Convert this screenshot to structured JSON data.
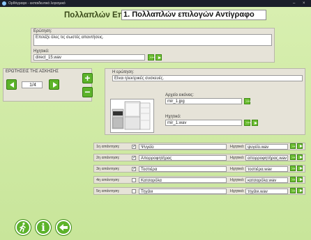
{
  "window": {
    "title": "Ορθόγραφο - εκπαιδευτικό λογισμικό"
  },
  "header": {
    "label": "Πολλαπλών Επιλογών:",
    "name_value": "1. Πολλαπλών επιλογών Αντίγραφο"
  },
  "instruction": {
    "label": "Ερώτηση:",
    "text": "Επιλέξε όλες τις σωστές απαντήσεις.",
    "sound_label": "Ηχητικό:",
    "sound_file": "direct_15.wav"
  },
  "questions_nav": {
    "label": "ΕΡΩΤΗΣΕΙΣ ΤΗΣ ΑΣΚΗΣΗΣ",
    "counter": "1/4"
  },
  "question": {
    "label": "Η ερώτηση:",
    "text": "Είναι ηλεκτρικές συσκευές.",
    "image_label": "Αρχείο εικόνας:",
    "image_file": "mir_1.jpg",
    "sound_label": "Ηχητικό:",
    "sound_file": "mir_1.wav"
  },
  "answers": [
    {
      "label": "1η απάντηση:",
      "checked": "✓",
      "text": "Ψυγείο",
      "sound_label": "Ηχητικό:",
      "sound_file": "ψυγείο.wav"
    },
    {
      "label": "2η απάντηση:",
      "checked": "✓",
      "text": "Απορροφητήρας",
      "sound_label": "Ηχητικό:",
      "sound_file": "απορροφητήρας.wav"
    },
    {
      "label": "3η απάντηση:",
      "checked": "✓",
      "text": "Τοστιέρα",
      "sound_label": "Ηχητικό:",
      "sound_file": "τοστιέρα.wav"
    },
    {
      "label": "4η απάντηση:",
      "checked": "",
      "text": "Κατσαρόλα",
      "sound_label": "Ηχητικό:",
      "sound_file": "κατσαρόλα.wav"
    },
    {
      "label": "5η απάντηση:",
      "checked": "",
      "text": "Τηγάνι",
      "sound_label": "Ηχητικό:",
      "sound_file": "τηγάνι.wav"
    }
  ],
  "colors": {
    "accent_green": "#5cb32a",
    "background": "#cfe8a2",
    "panel": "#e6e3d8"
  },
  "icons": [
    "exit-icon",
    "info-icon",
    "back-icon",
    "plus-icon",
    "minus-icon",
    "arrow-left-icon",
    "arrow-right-icon",
    "play-icon",
    "browse-icon"
  ]
}
